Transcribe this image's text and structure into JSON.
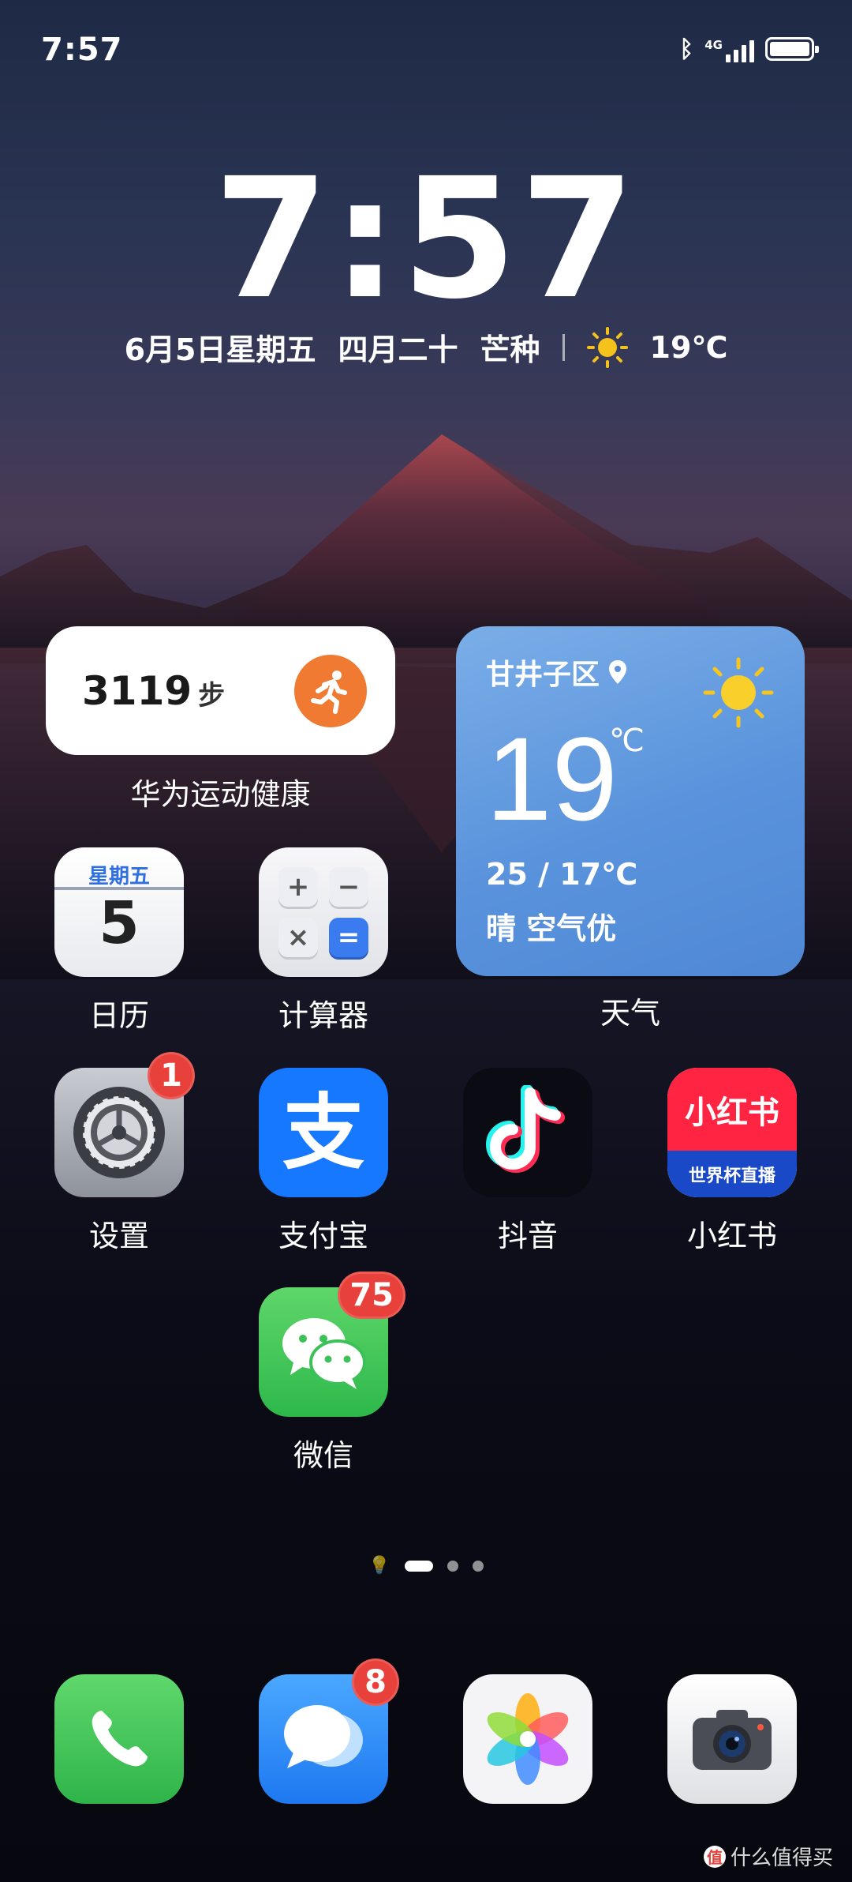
{
  "status_bar": {
    "time": "7:57",
    "network": "4G",
    "bluetooth": "on"
  },
  "lock_clock": {
    "time": "7:57",
    "date": "6月5日星期五",
    "lunar": "四月二十",
    "solar_term": "芒种",
    "temperature": "19℃"
  },
  "health_widget": {
    "steps": "3119",
    "unit": "步",
    "label": "华为运动健康"
  },
  "weather_widget": {
    "location": "甘井子区",
    "temp": "19",
    "unit": "℃",
    "range": "25 / 17℃",
    "description": "晴 空气优",
    "label": "天气"
  },
  "apps": {
    "calendar": {
      "label": "日历",
      "weekday": "星期五",
      "day": "5"
    },
    "calculator": {
      "label": "计算器",
      "keys": [
        "+",
        "−",
        "×",
        "="
      ]
    },
    "settings": {
      "label": "设置",
      "badge": "1"
    },
    "alipay": {
      "label": "支付宝",
      "glyph": "支"
    },
    "douyin": {
      "label": "抖音"
    },
    "xiaohongshu": {
      "label": "小红书",
      "top_text": "小红书",
      "bottom_text": "世界杯直播"
    },
    "wechat": {
      "label": "微信",
      "badge": "75"
    }
  },
  "dock": {
    "messages_badge": "8"
  },
  "watermark": {
    "logo": "值",
    "text": "什么值得买"
  },
  "colors": {
    "accent_orange": "#f07a32",
    "badge_red": "#e8403a",
    "weather_blue": "#5a93dc",
    "alipay_blue": "#1677ff"
  }
}
